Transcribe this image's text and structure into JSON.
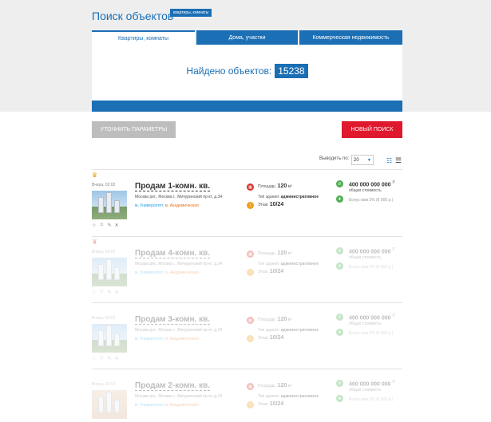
{
  "page": {
    "title": "Поиск объектов",
    "title_tag": "квартиры, комнаты"
  },
  "tabs": [
    {
      "label": "Квартиры, комнаты"
    },
    {
      "label": "Дома, участки"
    },
    {
      "label": "Коммерческая недвижимость"
    }
  ],
  "results": {
    "found_label": "Найдено объектов:",
    "found_count": "15238"
  },
  "buttons": {
    "refine": "УТОЧНИТЬ ПАРАМЕТРЫ",
    "new_search": "НОВЫЙ ПОИСК"
  },
  "toolbar": {
    "per_page_label": "Выводить по:",
    "per_page_value": "20"
  },
  "listings": [
    {
      "date": "Вчера, 02:02",
      "title": "Продам 1-комн. кв.",
      "address": "Москва рег., Москва г., Мичуринский пр-кт, д.34",
      "metro_1": "м. Университет,",
      "metro_2": "м. Академическая",
      "area_label": "Площадь:",
      "area_value": "120",
      "area_unit": "м²",
      "building_label": "Тип здания:",
      "building_value": "административное",
      "floor_label": "Этаж:",
      "floor_value": "10/24",
      "price": "400 000 000 000",
      "currency": "Р",
      "price_sub": "общая стоимость",
      "bonus": "Бонус вам 2% (8 000 р.)"
    },
    {
      "date": "Вчера, 02:02",
      "title": "Продам 4-комн. кв.",
      "address": "Москва рег., Москва г., Мичуринский пр-кт, д.34",
      "metro_1": "м. Университет,",
      "metro_2": "м. Академическая",
      "area_label": "Площадь:",
      "area_value": "120",
      "area_unit": "м²",
      "building_label": "Тип здания:",
      "building_value": "административное",
      "floor_label": "Этаж:",
      "floor_value": "10/24",
      "price": "400 000 000 000",
      "currency": "Р",
      "price_sub": "общая стоимость",
      "bonus": "Бонус вам 2% (8 000 р.)"
    },
    {
      "date": "Вчера, 02:02",
      "title": "Продам 3-комн. кв.",
      "address": "Москва рег., Москва г., Мичуринский пр-кт, д.34",
      "metro_1": "м. Университет,",
      "metro_2": "м. Академическая",
      "area_label": "Площадь:",
      "area_value": "120",
      "area_unit": "м²",
      "building_label": "Тип здания:",
      "building_value": "административное",
      "floor_label": "Этаж:",
      "floor_value": "10/24",
      "price": "400 000 000 000",
      "currency": "Р",
      "price_sub": "общая стоимость",
      "bonus": "Бонус вам 2% (8 000 р.)"
    },
    {
      "date": "Вчера, 02:02",
      "title": "Продам 2-комн. кв.",
      "address": "Москва рег., Москва г., Мичуринский пр-кт, д.34",
      "metro_1": "м. Университет,",
      "metro_2": "м. Академическая",
      "area_label": "Площадь:",
      "area_value": "120",
      "area_unit": "м²",
      "building_label": "Тип здания:",
      "building_value": "административное",
      "floor_label": "Этаж:",
      "floor_value": "10/24",
      "price": "400 000 000 000",
      "currency": "Р",
      "price_sub": "общая стоимость",
      "bonus": "Бонус вам 2% (8 000 р.)"
    }
  ]
}
